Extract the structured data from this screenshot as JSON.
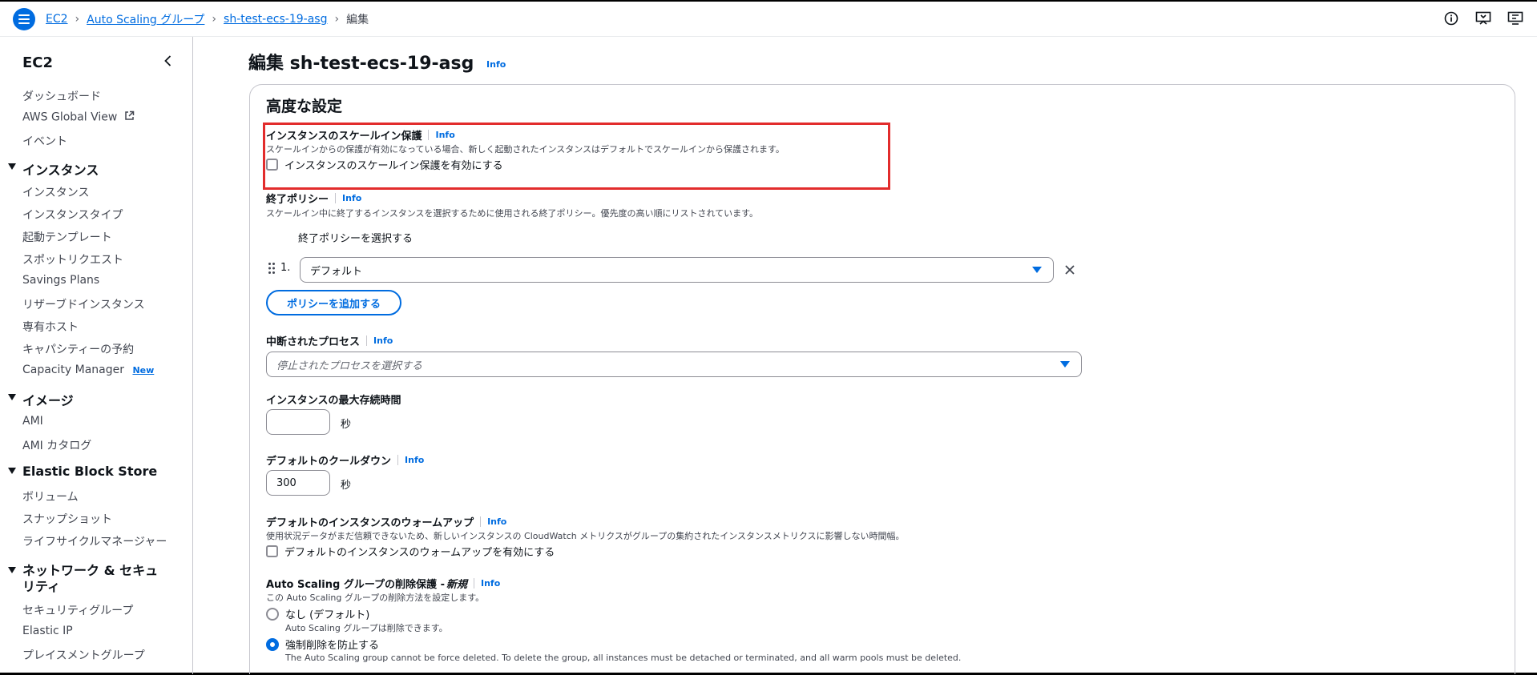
{
  "breadcrumb": {
    "items": [
      "EC2",
      "Auto Scaling グループ",
      "sh-test-ecs-19-asg"
    ],
    "current": "編集"
  },
  "top_icons": [
    "info-circle-icon",
    "feedback-icon",
    "settings-icon"
  ],
  "sidebar": {
    "title": "EC2",
    "top_items": [
      "ダッシュボード",
      "AWS Global View",
      "イベント"
    ],
    "sections": [
      {
        "title": "インスタンス",
        "items": [
          "インスタンス",
          "インスタンスタイプ",
          "起動テンプレート",
          "スポットリクエスト",
          "Savings Plans",
          "リザーブドインスタンス",
          "専有ホスト",
          "キャパシティーの予約",
          "Capacity Manager"
        ]
      },
      {
        "title": "イメージ",
        "items": [
          "AMI",
          "AMI カタログ"
        ]
      },
      {
        "title": "Elastic Block Store",
        "items": [
          "ボリューム",
          "スナップショット",
          "ライフサイクルマネージャー"
        ]
      },
      {
        "title": "ネットワーク & セキュリティ",
        "items": [
          "セキュリティグループ",
          "Elastic IP",
          "プレイスメントグループ"
        ]
      }
    ],
    "new_badge": "New"
  },
  "page": {
    "title": "編集 sh-test-ecs-19-asg",
    "info": "Info"
  },
  "panel": {
    "title": "高度な設定",
    "scale_in": {
      "label": "インスタンスのスケールイン保護",
      "desc": "スケールインからの保護が有効になっている場合、新しく起動されたインスタンスはデフォルトでスケールインから保護されます。",
      "checkbox": "インスタンスのスケールイン保護を有効にする"
    },
    "termination": {
      "label": "終了ポリシー",
      "desc": "スケールイン中に終了するインスタンスを選択するために使用される終了ポリシー。優先度の高い順にリストされています。",
      "select_label": "終了ポリシーを選択する",
      "index": "1.",
      "value": "デフォルト",
      "add_button": "ポリシーを追加する"
    },
    "suspended": {
      "label": "中断されたプロセス",
      "placeholder": "停止されたプロセスを選択する"
    },
    "max_lifetime": {
      "label": "インスタンスの最大存続時間",
      "value": "",
      "unit": "秒"
    },
    "cooldown": {
      "label": "デフォルトのクールダウン",
      "value": "300",
      "unit": "秒"
    },
    "warmup": {
      "label": "デフォルトのインスタンスのウォームアップ",
      "desc": "使用状況データがまだ信頼できないため、新しいインスタンスの CloudWatch メトリクスがグループの集約されたインスタンスメトリクスに影響しない時間幅。",
      "checkbox": "デフォルトのインスタンスのウォームアップを有効にする"
    },
    "deletion": {
      "label": "Auto Scaling グループの削除保護 - ",
      "label_new": "新規",
      "desc": "この Auto Scaling グループの削除方法を設定します。",
      "options": [
        {
          "label": "なし (デフォルト)",
          "desc": "Auto Scaling グループは削除できます。",
          "selected": false
        },
        {
          "label": "強制削除を防止する",
          "desc": "The Auto Scaling group cannot be force deleted. To delete the group, all instances must be detached or terminated, and all warm pools must be deleted.",
          "selected": true
        }
      ]
    }
  },
  "colors": {
    "accent": "#006ce0",
    "highlight": "#e22c2c",
    "border": "#c6c6cd"
  }
}
